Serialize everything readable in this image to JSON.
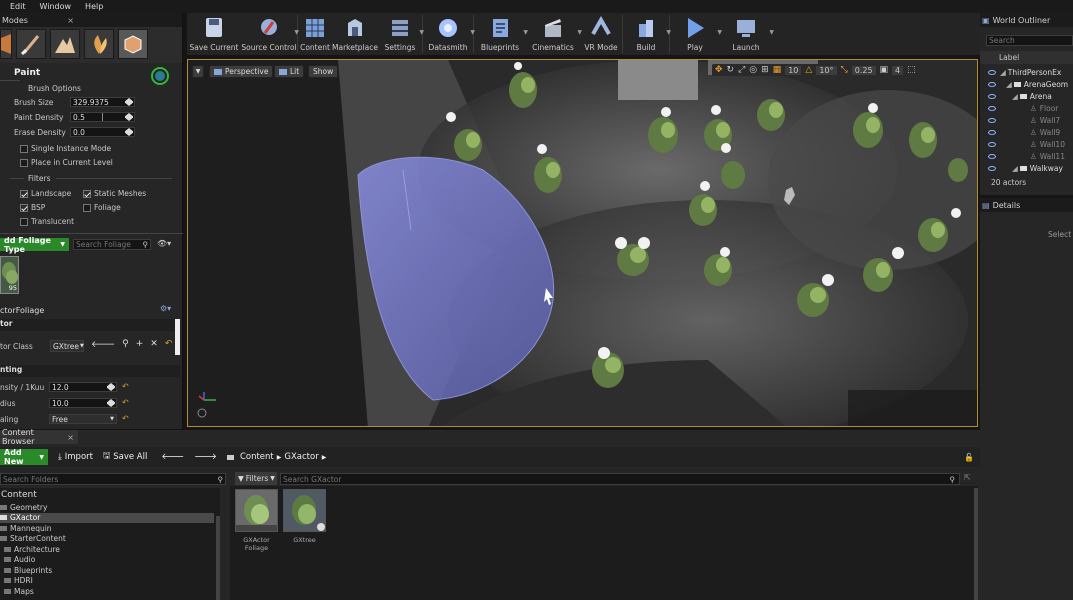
{
  "menu": [
    "Edit",
    "Window",
    "Help"
  ],
  "modes_tab": {
    "title": "Modes",
    "close": "×"
  },
  "paint": {
    "title": "Paint",
    "brush_options": "Brush Options",
    "brush_size_label": "Brush Size",
    "brush_size": "329.9375",
    "paint_density_label": "Paint Density",
    "paint_density": "0.5",
    "erase_density_label": "Erase Density",
    "erase_density": "0.0",
    "single_instance": "Single Instance Mode",
    "place_current_level": "Place in Current Level",
    "filters_title": "Filters",
    "filter_landscape": "Landscape",
    "filter_static_meshes": "Static Meshes",
    "filter_bsp": "BSP",
    "filter_foliage": "Foliage",
    "filter_translucent": "Translucent"
  },
  "foliage": {
    "add_type": "dd Foliage Type",
    "search_placeholder": "Search Foliage",
    "thumb_count": "95",
    "actor_title": "ctorFoliage",
    "actor_section": "tor",
    "actor_class_label": "tor Class",
    "actor_class_value": "GXtree",
    "painting_section": "nting",
    "density_label": "nsity / 1Kuu",
    "density_value": "12.0",
    "radius_label": "dius",
    "radius_value": "10.0",
    "scaling_label": "aling",
    "scaling_value": "Free"
  },
  "toolbar": [
    {
      "label": "Save Current",
      "color": "#6f8fbf"
    },
    {
      "label": "Source Control",
      "color": "#8aa6d8"
    },
    {
      "label": "Content",
      "color": "#7aa0d8"
    },
    {
      "label": "Marketplace",
      "color": "#9bb0d0"
    },
    {
      "label": "Settings",
      "color": "#8ea0c0"
    },
    {
      "label": "Datasmith",
      "color": "#a6c4ff"
    },
    {
      "label": "Blueprints",
      "color": "#8aa8e0"
    },
    {
      "label": "Cinematics",
      "color": "#b0b8c8"
    },
    {
      "label": "VR Mode",
      "color": "#a0b8e0"
    },
    {
      "label": "Build",
      "color": "#8aa8e0"
    },
    {
      "label": "Play",
      "color": "#6fa0e8"
    },
    {
      "label": "Launch",
      "color": "#9ab0d8"
    }
  ],
  "viewport": {
    "perspective": "Perspective",
    "lit": "Lit",
    "show": "Show",
    "grid_snap": "10",
    "rot_snap": "10°",
    "scale_snap": "0.25",
    "cam_speed": "4"
  },
  "outliner": {
    "title": "World Outliner",
    "search_placeholder": "Search",
    "label_col": "Label",
    "items": [
      "ThirdPersonEx",
      "ArenaGeom",
      "Arena",
      "Floor",
      "Wall7",
      "Wall9",
      "Wall10",
      "Wall11",
      "Walkway"
    ],
    "count": "20 actors"
  },
  "details": {
    "title": "Details",
    "hint": "Select"
  },
  "content_browser": {
    "tab": "Content Browser",
    "add_new": "Add New",
    "import": "Import",
    "save_all": "Save All",
    "path_root": "Content",
    "path_folder": "GXactor",
    "search_folders": "Search Folders",
    "filters": "Filters",
    "search_assets": "Search GXactor",
    "tree_root": "Content",
    "folders": [
      "Geometry",
      "GXactor",
      "Mannequin",
      "StarterContent",
      "Architecture",
      "Audio",
      "Blueprints",
      "HDRI",
      "Maps"
    ],
    "assets": [
      {
        "name": "GXActor Foliage"
      },
      {
        "name": "GXtree"
      }
    ]
  },
  "colors": {
    "accent_green": "#2a8a2a",
    "viewport_border": "#b58a2a",
    "brush_sphere": "#7478c8"
  }
}
